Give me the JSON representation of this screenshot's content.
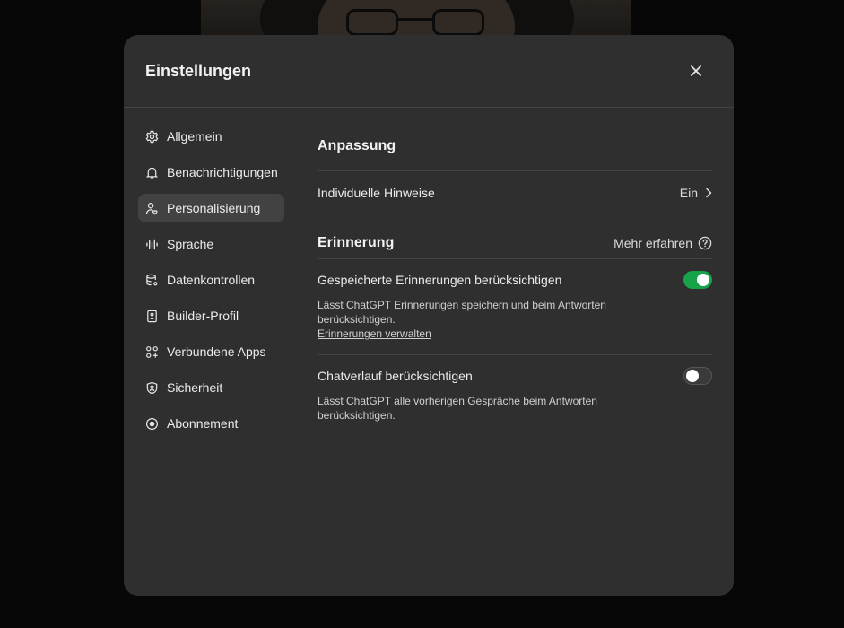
{
  "modal": {
    "title": "Einstellungen"
  },
  "sidebar": {
    "items": [
      {
        "label": "Allgemein",
        "icon": "gear-icon"
      },
      {
        "label": "Benachrichtigungen",
        "icon": "bell-icon"
      },
      {
        "label": "Personalisierung",
        "icon": "person-heart-icon",
        "active": true
      },
      {
        "label": "Sprache",
        "icon": "waveform-icon"
      },
      {
        "label": "Datenkontrollen",
        "icon": "database-icon"
      },
      {
        "label": "Builder-Profil",
        "icon": "id-card-icon"
      },
      {
        "label": "Verbundene Apps",
        "icon": "apps-grid-icon"
      },
      {
        "label": "Sicherheit",
        "icon": "shield-icon"
      },
      {
        "label": "Abonnement",
        "icon": "subscription-icon"
      }
    ]
  },
  "content": {
    "anpassung": {
      "title": "Anpassung",
      "custom_instructions_label": "Individuelle Hinweise",
      "custom_instructions_value": "Ein"
    },
    "erinnerung": {
      "title": "Erinnerung",
      "learn_more": "Mehr erfahren",
      "saved_memories": {
        "label": "Gespeicherte Erinnerungen berücksichtigen",
        "description": "Lässt ChatGPT Erinnerungen speichern und beim Antworten berücksichtigen.",
        "link": "Erinnerungen verwalten",
        "enabled": true
      },
      "chat_history": {
        "label": "Chatverlauf berücksichtigen",
        "description": "Lässt ChatGPT alle vorherigen Gespräche beim Antworten berücksichtigen.",
        "enabled": false
      }
    }
  },
  "colors": {
    "modal_bg": "#2f2f2f",
    "active_nav_bg": "#424242",
    "toggle_on": "#16a34a"
  }
}
